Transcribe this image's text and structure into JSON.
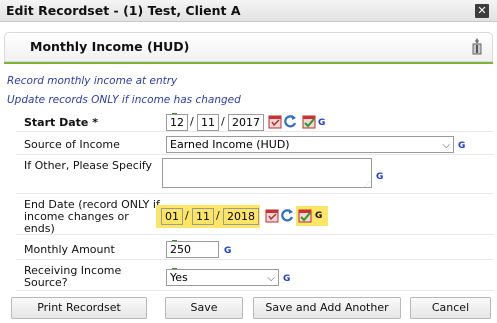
{
  "window": {
    "title": "Edit Recordset - (1) Test, Client A",
    "close_icon": "close-icon"
  },
  "section": {
    "title": "Monthly Income (HUD)",
    "tool_icon": "wrench-icon"
  },
  "notes": {
    "entry": "Record monthly income at entry",
    "update": "Update records ONLY if income has changed"
  },
  "fields": {
    "start_date": {
      "label": "Start Date *",
      "month": "12",
      "day": "11",
      "year": "2017",
      "sep": "/"
    },
    "source": {
      "label": "Source of Income",
      "value": "Earned Income (HUD)"
    },
    "other": {
      "label": "If Other, Please Specify",
      "value": ""
    },
    "end_date": {
      "label_line1": "End Date (record ONLY if",
      "label_line2": "income changes or",
      "label_line3": "ends)",
      "month": "01",
      "day": "11",
      "year": "2018",
      "sep": "/"
    },
    "monthly_amount": {
      "label": "Monthly Amount",
      "value": "250"
    },
    "receiving": {
      "label_line1": "Receiving Income",
      "label_line2": "Source?",
      "value": "Yes"
    }
  },
  "g_marker": "G",
  "buttons": {
    "print": "Print Recordset",
    "save": "Save",
    "save_add": "Save and Add Another",
    "cancel": "Cancel"
  },
  "colors": {
    "required_bar": "#3f8f1f",
    "highlight": "#ffe566",
    "g_link": "#1d3fbf",
    "note_text": "#2a3fa0"
  }
}
